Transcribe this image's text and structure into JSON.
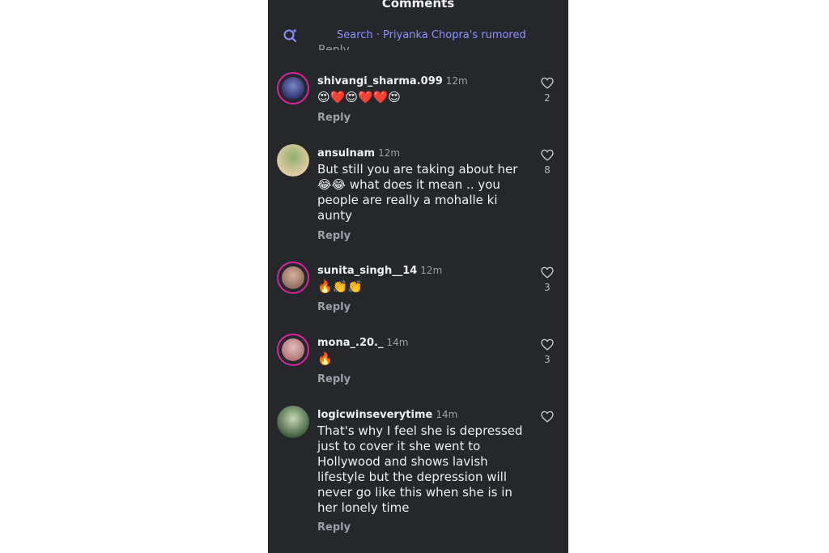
{
  "header": {
    "title": "Comments"
  },
  "search": {
    "text": "Search · Priyanka Chopra's rumored"
  },
  "clipped_reply": "Reply",
  "comments": [
    {
      "username": "shivangi_sharma.099",
      "time": "12m",
      "text": "😍❤️😍❤️❤️😍",
      "reply": "Reply",
      "likes": "2",
      "avatar_colors": [
        "#2b2f6b",
        "#7a86c4"
      ]
    },
    {
      "username": "ansulnam",
      "time": "12m",
      "text": "But still you are taking about her 😂😂 what does it mean .. you people are really a mohalle ki aunty",
      "reply": "Reply",
      "likes": "8",
      "avatar_colors": [
        "#e7cfa9",
        "#8fae6e"
      ]
    },
    {
      "username": "sunita_singh__14",
      "time": "12m",
      "text": "🔥👏👏",
      "reply": "Reply",
      "likes": "3",
      "avatar_colors": [
        "#8c6a5e",
        "#d7b39c"
      ]
    },
    {
      "username": "mona_.20._",
      "time": "14m",
      "text": "🔥",
      "reply": "Reply",
      "likes": "3",
      "avatar_colors": [
        "#b07078",
        "#e2c1b9"
      ]
    },
    {
      "username": "logicwinseverytime",
      "time": "14m",
      "text": "That's why I feel she is depressed just to cover it she went to Hollywood and shows lavish lifestyle but the depression will never go like this when she is in her lonely time",
      "reply": "Reply",
      "likes": "",
      "avatar_colors": [
        "#3a5a3a",
        "#c8d9b4"
      ]
    }
  ]
}
